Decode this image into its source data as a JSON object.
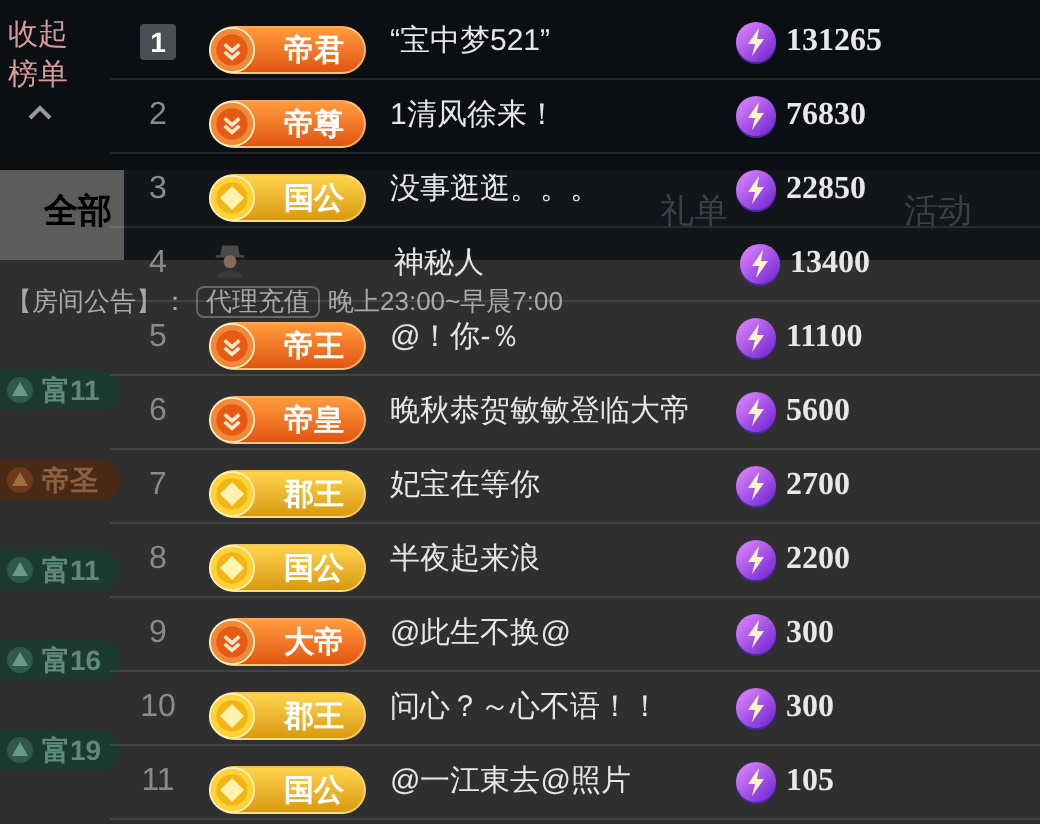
{
  "sidebar": {
    "collapse_label": "收起榜单"
  },
  "background": {
    "tabs": [
      {
        "label": "全部",
        "selected": true
      },
      {
        "label": "礼单",
        "selected": false
      },
      {
        "label": "活动",
        "selected": false
      }
    ],
    "notice": {
      "label": "【房间公告】：",
      "tag": "代理充值",
      "text": "晚上23:00~早晨7:00"
    },
    "chat_badges": [
      {
        "kind": "wealth",
        "label": "富11"
      },
      {
        "kind": "noble",
        "label": "帝圣"
      },
      {
        "kind": "wealth",
        "label": "富11"
      },
      {
        "kind": "wealth",
        "label": "富16"
      },
      {
        "kind": "wealth",
        "label": "富19"
      }
    ]
  },
  "ranking": [
    {
      "rank": "1",
      "highlighted": true,
      "badge": {
        "kind": "orange",
        "label": "帝君"
      },
      "name": "“宝中梦521”",
      "score": "131265"
    },
    {
      "rank": "2",
      "highlighted": false,
      "badge": {
        "kind": "orange",
        "label": "帝尊"
      },
      "name": "1清风徐来！",
      "score": "76830"
    },
    {
      "rank": "3",
      "highlighted": false,
      "badge": {
        "kind": "gold",
        "label": "国公"
      },
      "name": "没事逛逛。。。",
      "score": "22850"
    },
    {
      "rank": "4",
      "highlighted": false,
      "badge": {
        "kind": "mystery"
      },
      "name": "神秘人",
      "score": "13400"
    },
    {
      "rank": "5",
      "highlighted": false,
      "badge": {
        "kind": "orange",
        "label": "帝王"
      },
      "name": "@！你-％",
      "score": "11100"
    },
    {
      "rank": "6",
      "highlighted": false,
      "badge": {
        "kind": "orange",
        "label": "帝皇"
      },
      "name": "晚秋恭贺敏敏登临大帝",
      "score": "5600"
    },
    {
      "rank": "7",
      "highlighted": false,
      "badge": {
        "kind": "gold",
        "label": "郡王"
      },
      "name": "妃宝在等你",
      "score": "2700"
    },
    {
      "rank": "8",
      "highlighted": false,
      "badge": {
        "kind": "gold",
        "label": "国公"
      },
      "name": "半夜起来浪",
      "score": "2200"
    },
    {
      "rank": "9",
      "highlighted": false,
      "badge": {
        "kind": "orange",
        "label": "大帝"
      },
      "name": "@此生不换@",
      "score": "300"
    },
    {
      "rank": "10",
      "highlighted": false,
      "badge": {
        "kind": "gold",
        "label": "郡王"
      },
      "name": "问心？～心不语！！",
      "score": "300"
    },
    {
      "rank": "11",
      "highlighted": false,
      "badge": {
        "kind": "gold",
        "label": "国公"
      },
      "name": "@一江東去@照片",
      "score": "105"
    }
  ]
}
